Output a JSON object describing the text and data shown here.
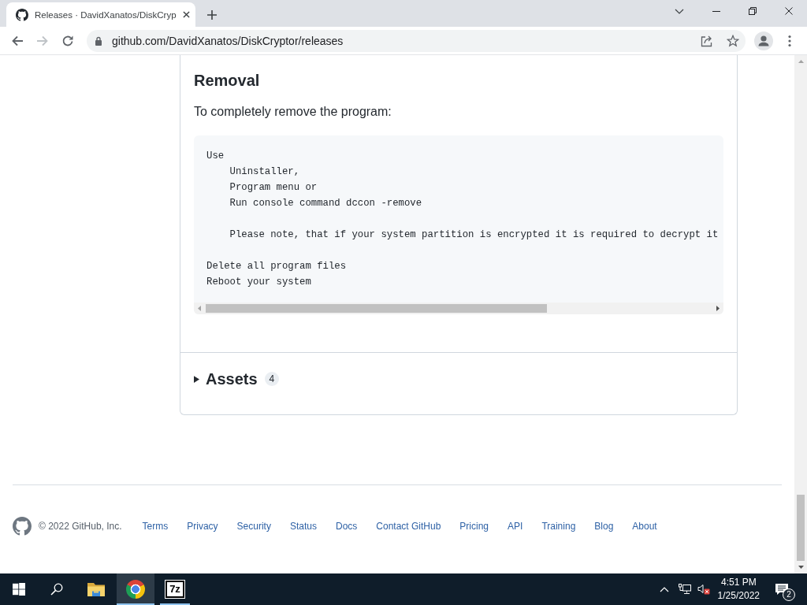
{
  "browser": {
    "tabs": [
      {
        "title": "Releases · DavidXanatos/DiskCryp",
        "selected": true
      }
    ],
    "nav_buttons": [
      {
        "kind": "back",
        "disabled": false
      },
      {
        "kind": "forward",
        "disabled": true
      },
      {
        "kind": "reload",
        "disabled": false
      }
    ],
    "address": "github.com/DavidXanatos/DiskCryptor/releases"
  },
  "release": {
    "heading": "Removal",
    "text": "To completely remove the program:",
    "code": "Use\n    Uninstaller,\n    Program menu or\n    Run console command dccon -remove\n\n    Please note, that if your system partition is encrypted it is required to decrypt it\n\nDelete all program files\nReboot your system"
  },
  "assets": {
    "label": "Assets",
    "count": "4",
    "expanded": false
  },
  "footer": {
    "copyright": "© 2022 GitHub, Inc.",
    "links": [
      "Terms",
      "Privacy",
      "Security",
      "Status",
      "Docs",
      "Contact GitHub",
      "Pricing",
      "API",
      "Training",
      "Blog",
      "About"
    ]
  },
  "taskbar": {
    "apps": [
      {
        "kind": "folder",
        "running": false,
        "selected": false
      },
      {
        "kind": "chrome",
        "running": true,
        "selected": true
      },
      {
        "kind": "archiver",
        "label": "7z",
        "running": true,
        "selected": false
      }
    ],
    "tray": {
      "muted": true,
      "time": "4:51 PM",
      "date": "1/25/2022",
      "notification_count": "2"
    }
  }
}
